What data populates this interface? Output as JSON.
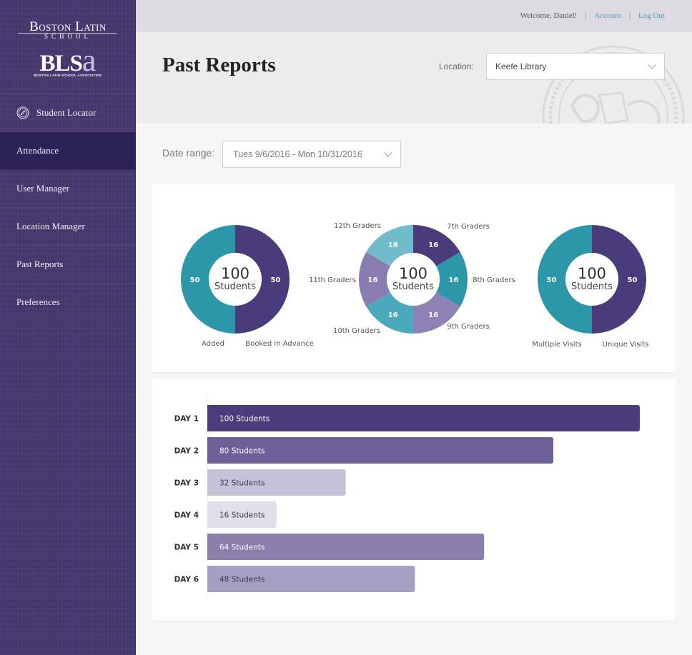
{
  "sidebar": {
    "logo": {
      "name": "Boston Latin",
      "school": "SCHOOL",
      "blsa_main": "BLS",
      "blsa_accent": "a",
      "assoc": "BOSTON LATIN SCHOOL ASSOCIATION"
    },
    "items": [
      {
        "label": "Student Locator",
        "icon": "compass-icon",
        "active": false
      },
      {
        "label": "Attendance",
        "active": true
      },
      {
        "label": "User Manager",
        "active": false
      },
      {
        "label": "Location Manager",
        "active": false
      },
      {
        "label": "Past Reports",
        "active": false
      },
      {
        "label": "Preferences",
        "active": false
      }
    ]
  },
  "topbar": {
    "welcome": "Welcome, Daniel!",
    "separator": "|",
    "account": "Account",
    "logout": "Log Out"
  },
  "header": {
    "title": "Past Reports",
    "location_label": "Location:",
    "location_value": "Keefe Library"
  },
  "filters": {
    "date_label": "Date range:",
    "date_value": "Tues 9/6/2016 - Mon 10/31/2016"
  },
  "colors": {
    "sidebar": "#46376f",
    "sidebar_active": "#2d2255",
    "link": "#4a9fc2"
  },
  "chart_data": [
    {
      "type": "pie",
      "variant": "donut",
      "center_value": "100",
      "center_label": "Students",
      "slices": [
        {
          "label": "Booked in Advance",
          "value": 50,
          "color": "#4a3b7d"
        },
        {
          "label": "Added",
          "value": 50,
          "color": "#2b97a8"
        }
      ]
    },
    {
      "type": "pie",
      "variant": "donut",
      "center_value": "100",
      "center_label": "Students",
      "slices": [
        {
          "label": "7th Graders",
          "value": 16,
          "color": "#4a3b7d"
        },
        {
          "label": "8th Graders",
          "value": 16,
          "color": "#2b97a8"
        },
        {
          "label": "9th Graders",
          "value": 16,
          "color": "#8e81b3"
        },
        {
          "label": "10th Graders",
          "value": 16,
          "color": "#4aaabb"
        },
        {
          "label": "11th Graders",
          "value": 16,
          "color": "#8a7bb1"
        },
        {
          "label": "12th Graders",
          "value": 16,
          "color": "#71bccb"
        }
      ]
    },
    {
      "type": "pie",
      "variant": "donut",
      "center_value": "100",
      "center_label": "Students",
      "slices": [
        {
          "label": "Unique Visits",
          "value": 50,
          "color": "#4a3b7d"
        },
        {
          "label": "Multiple Visits",
          "value": 50,
          "color": "#2b97a8"
        }
      ]
    },
    {
      "type": "bar",
      "orientation": "horizontal",
      "categories": [
        "DAY 1",
        "DAY 2",
        "DAY 3",
        "DAY 4",
        "DAY 5",
        "DAY 6"
      ],
      "values": [
        100,
        80,
        32,
        16,
        64,
        48
      ],
      "value_labels": [
        "100 Students",
        "80 Students",
        "32 Students",
        "16 Students",
        "64 Students",
        "48 Students"
      ],
      "colors": [
        "#4b3c7c",
        "#6d5f98",
        "#c5c1d7",
        "#e1dfe9",
        "#8a7eab",
        "#a69fc4"
      ],
      "label_colors": [
        "#ffffff",
        "#ffffff",
        "#3a3a4a",
        "#3a3a4a",
        "#ffffff",
        "#3a3a4a"
      ],
      "xlim": [
        0,
        100
      ],
      "title": "",
      "xlabel": "",
      "ylabel": ""
    }
  ]
}
